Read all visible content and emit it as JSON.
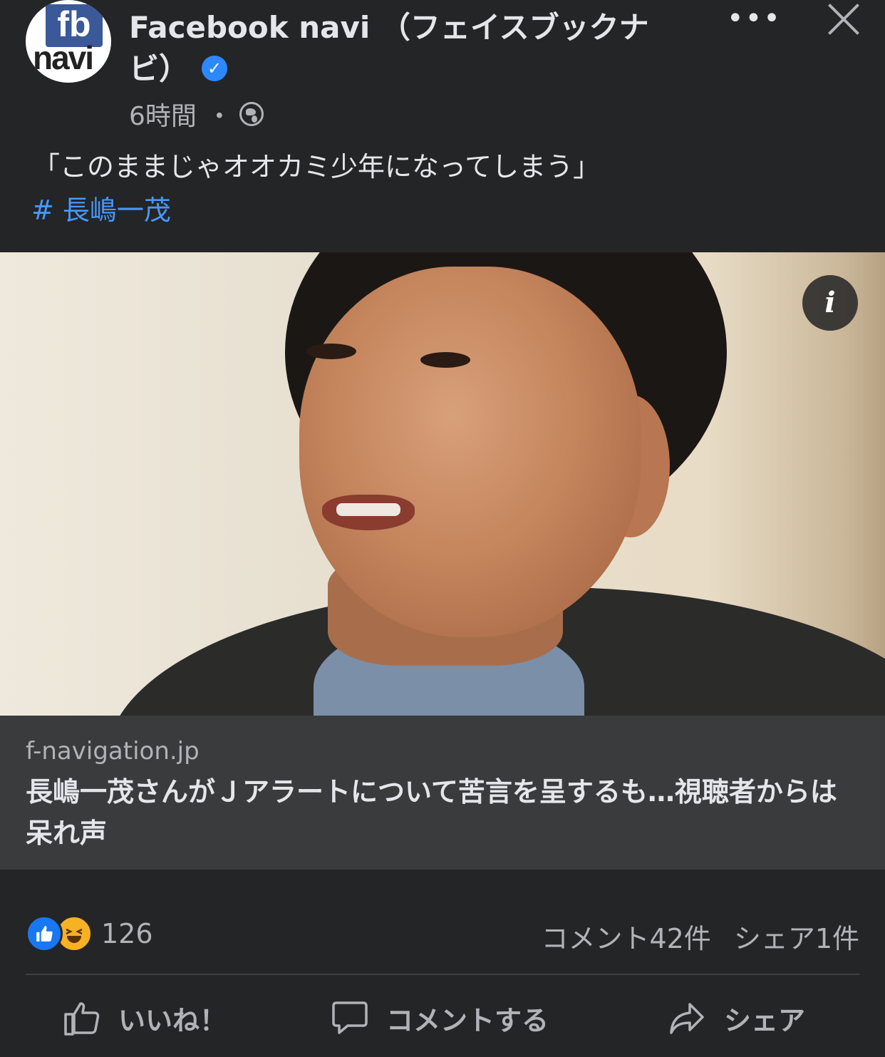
{
  "post": {
    "page_name": "Facebook navi （フェイスブックナビ）",
    "verified_mark": "✓",
    "time": "6時間",
    "separator": "・",
    "text": "「このままじゃオオカミ少年になってしまう」",
    "hashtag": "# 長嶋一茂"
  },
  "avatar": {
    "line1": "fb",
    "line2": "navi"
  },
  "header": {
    "more_label": "•••"
  },
  "image": {
    "info_label": "i"
  },
  "link": {
    "domain": "f-navigation.jp",
    "title": "長嶋一茂さんがＪアラートについて苦言を呈するも…視聴者からは呆れ声"
  },
  "reactions": {
    "icons": [
      "like-icon",
      "haha-icon"
    ],
    "count": "126",
    "comments": "コメント42件",
    "shares": "シェア1件"
  },
  "actions": {
    "like_label": "いいね！",
    "comment_label": "コメントする",
    "share_label": "シェア"
  },
  "colors": {
    "background": "#242526",
    "link_box": "#3a3b3c",
    "hashtag": "#4599ff",
    "verified": "#2d88ff",
    "like": "#1877f2",
    "haha": "#f7b125"
  }
}
